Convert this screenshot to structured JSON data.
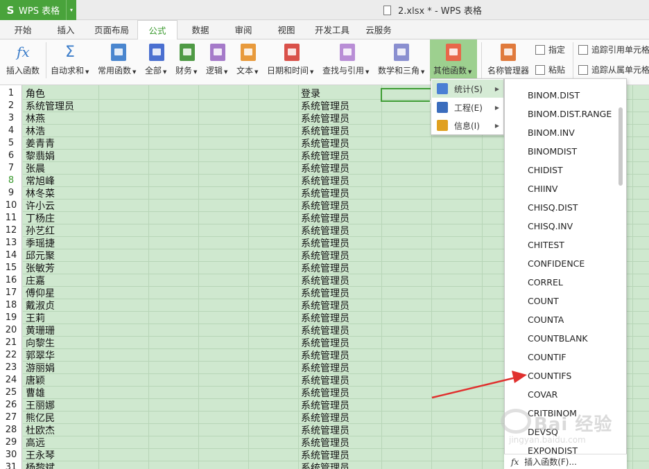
{
  "app": {
    "name": "WPS 表格",
    "logo_glyph": "S",
    "dropdown_glyph": "▾"
  },
  "window_title": "2.xlsx * - WPS 表格",
  "tabs": [
    "开始",
    "插入",
    "页面布局",
    "公式",
    "数据",
    "审阅",
    "视图",
    "开发工具",
    "云服务"
  ],
  "active_tab": "公式",
  "ribbon": {
    "insert_function": "插入函数",
    "autosum": "自动求和",
    "common": "常用函数",
    "all": "全部",
    "finance": "财务",
    "logic": "逻辑",
    "text": "文本",
    "datetime": "日期和时间",
    "lookup": "查找与引用",
    "math": "数学和三角",
    "other": "其他函数",
    "name_manager": "名称管理器",
    "define": "指定",
    "paste": "粘贴",
    "trace_precedents": "追踪引用单元格",
    "trace_dependents": "追踪从属单元格",
    "fx_glyph": "fx",
    "sigma_glyph": "Σ"
  },
  "sheet": {
    "row_numbers": [
      "1",
      "2",
      "3",
      "4",
      "5",
      "6",
      "7",
      "8",
      "9",
      "10",
      "11",
      "12",
      "13",
      "14",
      "15",
      "16",
      "17",
      "18",
      "19",
      "20",
      "21",
      "22",
      "23",
      "24",
      "25",
      "26",
      "27",
      "28",
      "29",
      "30",
      "31"
    ],
    "active_row": "8",
    "col_a": [
      "角色",
      "系统管理员",
      "林燕",
      "林浩",
      "姜青青",
      "黎翡娟",
      "张晨",
      "常旭峰",
      "林冬菜",
      "许小云",
      "丁杨庄",
      "孙艺红",
      "季瑶捷",
      "邱元聚",
      "张敏芳",
      "庄嘉",
      "傅仰星",
      "戴淑贞",
      "王莉",
      "黄珊珊",
      "向黎生",
      "郭翠华",
      "游丽娟",
      "唐颖",
      "曹雄",
      "王丽娜",
      "熊亿民",
      "杜欧杰",
      "高远",
      "王永琴",
      "杨黎斌"
    ],
    "col_f": [
      "登录",
      "系统管理员",
      "系统管理员",
      "系统管理员",
      "系统管理员",
      "系统管理员",
      "系统管理员",
      "系统管理员",
      "系统管理员",
      "系统管理员",
      "系统管理员",
      "系统管理员",
      "系统管理员",
      "系统管理员",
      "系统管理员",
      "系统管理员",
      "系统管理员",
      "系统管理员",
      "系统管理员",
      "系统管理员",
      "系统管理员",
      "系统管理员",
      "系统管理员",
      "系统管理员",
      "系统管理员",
      "系统管理员",
      "系统管理员",
      "系统管理员",
      "系统管理员",
      "系统管理员",
      "系统管理员"
    ]
  },
  "category_menu": [
    {
      "label": "统计(S)",
      "icon": "statistics-icon",
      "color": "#4a7fd4"
    },
    {
      "label": "工程(E)",
      "icon": "engineering-icon",
      "color": "#3b6dbd"
    },
    {
      "label": "信息(I)",
      "icon": "info-icon",
      "color": "#e0a020"
    }
  ],
  "function_menu": [
    "BINOM.DIST",
    "BINOM.DIST.RANGE",
    "BINOM.INV",
    "BINOMDIST",
    "CHIDIST",
    "CHIINV",
    "CHISQ.DIST",
    "CHISQ.INV",
    "CHITEST",
    "CONFIDENCE",
    "CORREL",
    "COUNT",
    "COUNTA",
    "COUNTBLANK",
    "COUNTIF",
    "COUNTIFS",
    "COVAR",
    "CRITBINOM",
    "DEVSQ",
    "EXPONDIST"
  ],
  "insert_function_footer": {
    "glyph": "fx",
    "label": "插入函数(F)..."
  },
  "watermark": {
    "text": "Bai 经验",
    "url": "jingyan.baidu.com"
  },
  "colors": {
    "accent": "#3a9a2e",
    "sheet_bg": "#cfe8cf",
    "arrow": "#e0302e"
  }
}
